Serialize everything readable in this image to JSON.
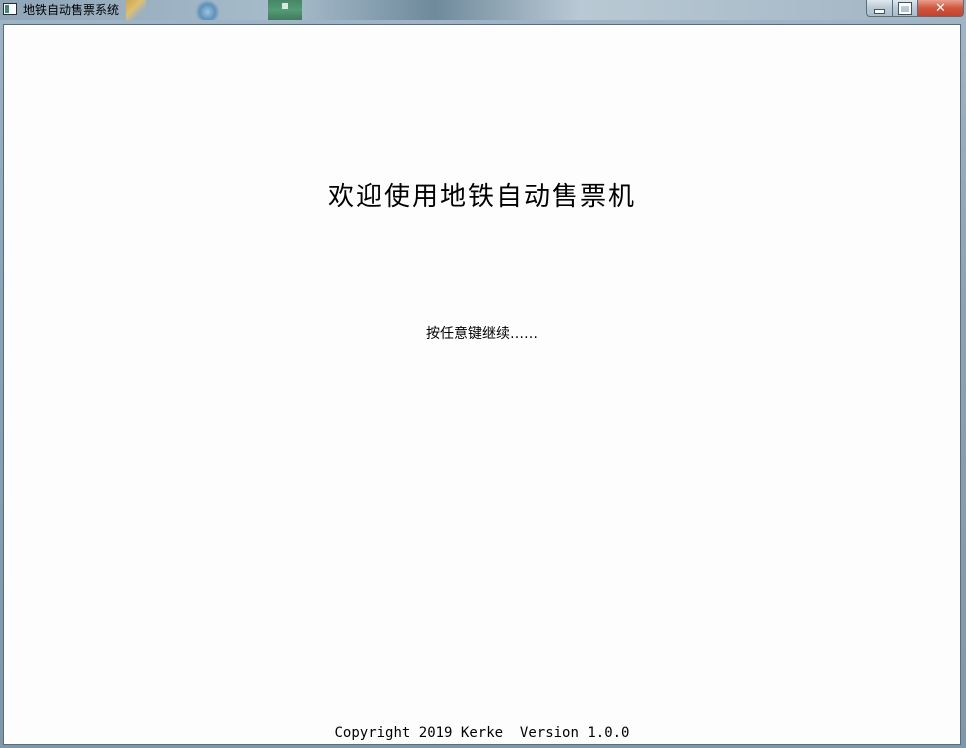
{
  "window": {
    "title": "地铁自动售票系统",
    "close_label": "✕"
  },
  "main": {
    "welcome_text": "欢迎使用地铁自动售票机",
    "prompt_text": "按任意键继续……",
    "footer_text": "Copyright 2019 Kerke  Version 1.0.0"
  }
}
